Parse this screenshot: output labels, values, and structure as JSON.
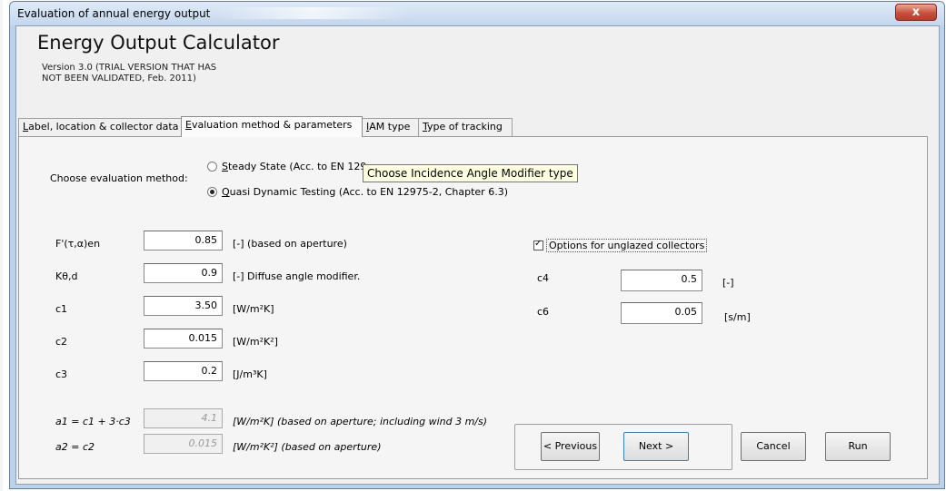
{
  "window": {
    "title": "Evaluation of annual energy output",
    "close_glyph": "x"
  },
  "header": {
    "title": "Energy Output Calculator",
    "version_line1": "Version 3.0 (TRIAL VERSION THAT HAS",
    "version_line2": "NOT BEEN VALIDATED, Feb. 2011)"
  },
  "tabs": [
    {
      "accel": "L",
      "rest": "abel, location & collector data",
      "active": false
    },
    {
      "accel": "E",
      "rest": "valuation method & parameters",
      "active": true
    },
    {
      "accel": "I",
      "rest": "AM type",
      "active": false
    },
    {
      "accel": "T",
      "rest": "ype of tracking",
      "active": false
    }
  ],
  "method": {
    "label": "Choose evaluation method:",
    "options": [
      {
        "accel": "S",
        "text": "teady State (Acc. to EN 129",
        "checked": false
      },
      {
        "accel": "Q",
        "text": "uasi Dynamic Testing (Acc. to EN 12975-2, Chapter 6.3)",
        "checked": true
      }
    ]
  },
  "tooltip": "Choose Incidence Angle Modifier type",
  "params": [
    {
      "label": "F'(τ,α)en",
      "value": "0.85",
      "unit": "[-]  (based on aperture)"
    },
    {
      "label": "Kθ,d",
      "value": "0.9",
      "unit": "[-]  Diffuse angle modifier."
    },
    {
      "label": "c1",
      "value": "3.50",
      "unit": "[W/m²K]"
    },
    {
      "label": "c2",
      "value": "0.015",
      "unit": "[W/m²K²]"
    },
    {
      "label": "c3",
      "value": "0.2",
      "unit": "[J/m³K]"
    }
  ],
  "derived": [
    {
      "label": "a1 = c1 + 3·c3",
      "value": "4.1",
      "unit": "[W/m²K] (based on aperture; including wind 3 m/s)"
    },
    {
      "label": "a2 = c2",
      "value": "0.015",
      "unit": "[W/m²K²]  (based on aperture)"
    }
  ],
  "unglazed": {
    "checkbox_label": "Options for unglazed collectors",
    "checked": true,
    "c4": {
      "label": "c4",
      "value": "0.5",
      "unit": "[-]"
    },
    "c6": {
      "label": "c6",
      "value": "0.05",
      "unit": "[s/m]"
    }
  },
  "buttons": {
    "previous": "< Previous",
    "next": "Next >",
    "cancel": "Cancel",
    "run": "Run"
  },
  "colors": {
    "window_frame": "#bcd2ea",
    "tooltip_bg": "#ffffe1",
    "close_button": "#c8503d"
  }
}
